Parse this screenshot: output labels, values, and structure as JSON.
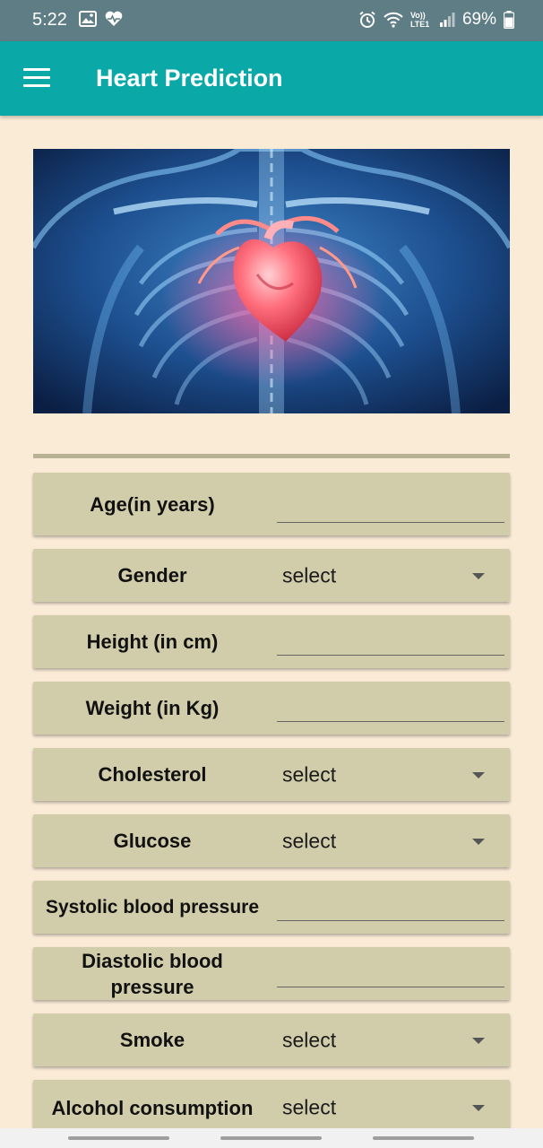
{
  "status_bar": {
    "time": "5:22",
    "network": "Vo)) LTE1",
    "battery": "69%"
  },
  "app_bar": {
    "title": "Heart Prediction",
    "menu_icon": "hamburger-menu-icon"
  },
  "hero_image": {
    "subject": "human-heart-anatomy"
  },
  "form": {
    "age": {
      "label": "Age(in years)",
      "value": ""
    },
    "gender": {
      "label": "Gender",
      "value": "select"
    },
    "height": {
      "label": "Height (in cm)",
      "value": ""
    },
    "weight": {
      "label": "Weight (in Kg)",
      "value": ""
    },
    "cholesterol": {
      "label": "Cholesterol",
      "value": "select"
    },
    "glucose": {
      "label": "Glucose",
      "value": "select"
    },
    "systolic": {
      "label": "Systolic blood pressure",
      "value": ""
    },
    "diastolic": {
      "label": "Diastolic blood pressure",
      "value": ""
    },
    "smoke": {
      "label": "Smoke",
      "value": "select"
    },
    "alcohol": {
      "label": "Alcohol consumption",
      "value": "select"
    }
  },
  "colors": {
    "status_bar": "#5f7d84",
    "app_bar": "#0aa9a8",
    "background": "#faebd7",
    "field_background": "#d1cdab",
    "divider": "#b9b294"
  }
}
